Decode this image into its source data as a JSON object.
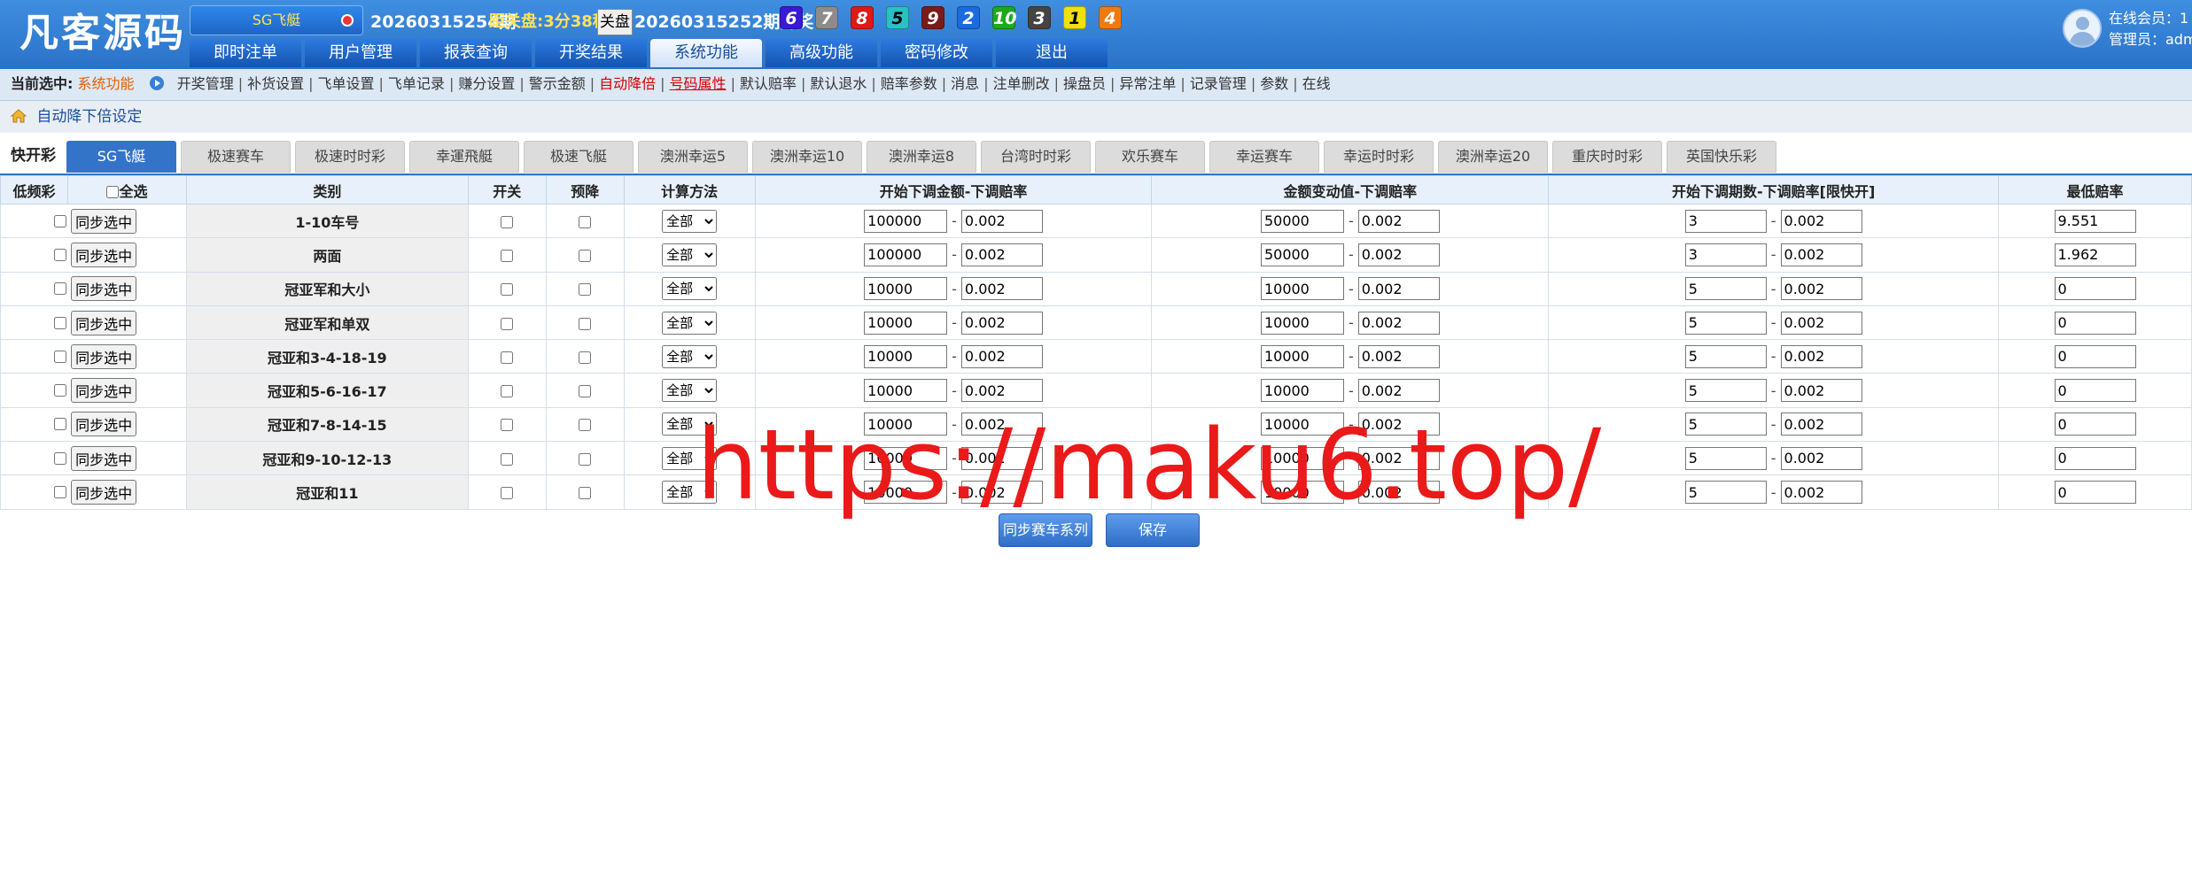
{
  "header": {
    "logo": "凡客源码",
    "lottery_select": "SG飞艇",
    "current_period": "20260315254期",
    "close_countdown": "距关盘:3分38秒",
    "close_button": "关盘",
    "last_period": "20260315252期开奖:",
    "balls": [
      {
        "num": "6",
        "color": "#3a1ad4"
      },
      {
        "num": "7",
        "color": "#8c8c8c"
      },
      {
        "num": "8",
        "color": "#e01818"
      },
      {
        "num": "5",
        "color": "#2ac0c8"
      },
      {
        "num": "9",
        "color": "#7a1a1a"
      },
      {
        "num": "2",
        "color": "#1a6ae0"
      },
      {
        "num": "10",
        "color": "#1caa1c"
      },
      {
        "num": "3",
        "color": "#444444"
      },
      {
        "num": "1",
        "color": "#f0e010"
      },
      {
        "num": "4",
        "color": "#f07a10"
      }
    ],
    "nav": [
      "即时注单",
      "用户管理",
      "报表查询",
      "开奖结果",
      "系统功能",
      "高级功能",
      "密码修改",
      "退出"
    ],
    "nav_active_index": 4,
    "online_members": "在线会员：1",
    "admin": "管理员：adm"
  },
  "subnav": {
    "current_label": "当前选中:",
    "current_value": "系统功能",
    "items": [
      {
        "label": "开奖管理",
        "style": ""
      },
      {
        "label": "补货设置",
        "style": ""
      },
      {
        "label": "飞单设置",
        "style": ""
      },
      {
        "label": "飞单记录",
        "style": ""
      },
      {
        "label": "赚分设置",
        "style": ""
      },
      {
        "label": "警示金额",
        "style": ""
      },
      {
        "label": "自动降倍",
        "style": "red"
      },
      {
        "label": "号码属性",
        "style": "red ul"
      },
      {
        "label": "默认赔率",
        "style": ""
      },
      {
        "label": "默认退水",
        "style": ""
      },
      {
        "label": "赔率参数",
        "style": ""
      },
      {
        "label": "消息",
        "style": ""
      },
      {
        "label": "注单删改",
        "style": ""
      },
      {
        "label": "操盘员",
        "style": ""
      },
      {
        "label": "异常注单",
        "style": ""
      },
      {
        "label": "记录管理",
        "style": ""
      },
      {
        "label": "参数",
        "style": ""
      },
      {
        "label": "在线",
        "style": ""
      }
    ]
  },
  "breadcrumb": "自动降下倍设定",
  "tabs": {
    "label": "快开彩",
    "items": [
      "SG飞艇",
      "极速赛车",
      "极速时时彩",
      "幸運飛艇",
      "极速飞艇",
      "澳洲幸运5",
      "澳洲幸运10",
      "澳洲幸运8",
      "台湾时时彩",
      "欢乐赛车",
      "幸运赛车",
      "幸运时时彩",
      "澳洲幸运20",
      "重庆时时彩",
      "英国快乐彩"
    ],
    "active_index": 0
  },
  "table": {
    "headers": [
      "低频彩",
      "全选",
      "类别",
      "开关",
      "预降",
      "计算方法",
      "开始下调金额-下调赔率",
      "金额变动值-下调赔率",
      "开始下调期数-下调赔率[限快开]",
      "最低赔率"
    ],
    "sync_button": "同步选中",
    "select_value": "全部",
    "rows": [
      {
        "category": "1-10车号",
        "amt": "100000",
        "amt_rate": "0.002",
        "chg": "50000",
        "chg_rate": "0.002",
        "cnt": "3",
        "cnt_rate": "0.002",
        "min": "9.551"
      },
      {
        "category": "两面",
        "amt": "100000",
        "amt_rate": "0.002",
        "chg": "50000",
        "chg_rate": "0.002",
        "cnt": "3",
        "cnt_rate": "0.002",
        "min": "1.962"
      },
      {
        "category": "冠亚军和大小",
        "amt": "10000",
        "amt_rate": "0.002",
        "chg": "10000",
        "chg_rate": "0.002",
        "cnt": "5",
        "cnt_rate": "0.002",
        "min": "0"
      },
      {
        "category": "冠亚军和单双",
        "amt": "10000",
        "amt_rate": "0.002",
        "chg": "10000",
        "chg_rate": "0.002",
        "cnt": "5",
        "cnt_rate": "0.002",
        "min": "0"
      },
      {
        "category": "冠亚和3-4-18-19",
        "amt": "10000",
        "amt_rate": "0.002",
        "chg": "10000",
        "chg_rate": "0.002",
        "cnt": "5",
        "cnt_rate": "0.002",
        "min": "0"
      },
      {
        "category": "冠亚和5-6-16-17",
        "amt": "10000",
        "amt_rate": "0.002",
        "chg": "10000",
        "chg_rate": "0.002",
        "cnt": "5",
        "cnt_rate": "0.002",
        "min": "0"
      },
      {
        "category": "冠亚和7-8-14-15",
        "amt": "10000",
        "amt_rate": "0.002",
        "chg": "10000",
        "chg_rate": "0.002",
        "cnt": "5",
        "cnt_rate": "0.002",
        "min": "0"
      },
      {
        "category": "冠亚和9-10-12-13",
        "amt": "10000",
        "amt_rate": "0.002",
        "chg": "10000",
        "chg_rate": "0.002",
        "cnt": "5",
        "cnt_rate": "0.002",
        "min": "0"
      },
      {
        "category": "冠亚和11",
        "amt": "10000",
        "amt_rate": "0.002",
        "chg": "10000",
        "chg_rate": "0.002",
        "cnt": "5",
        "cnt_rate": "0.002",
        "min": "0"
      }
    ]
  },
  "actions": {
    "sync_series": "同步赛车系列",
    "save": "保存"
  },
  "watermark": "https://maku6.top/"
}
